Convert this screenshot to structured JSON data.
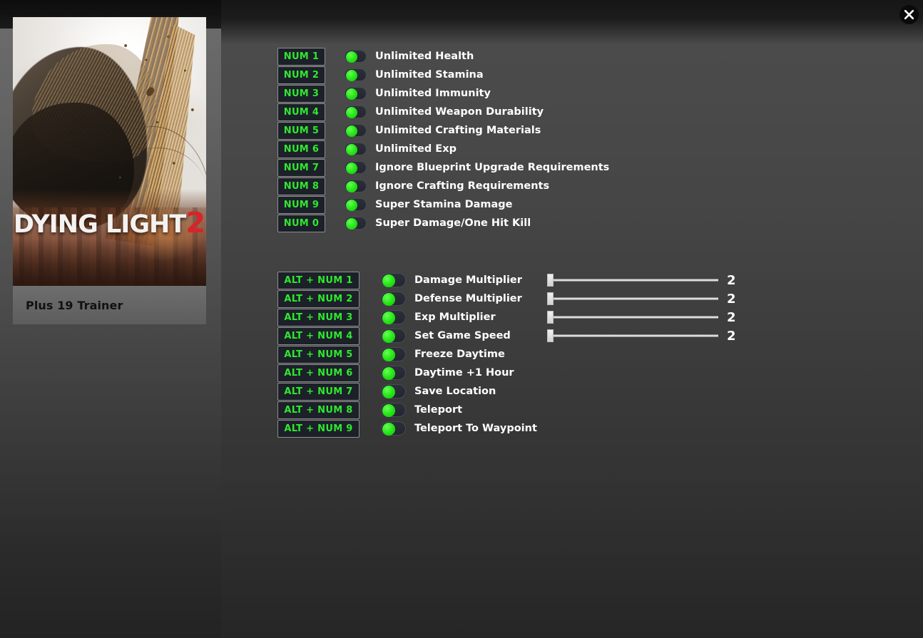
{
  "window": {
    "close_icon": "close-icon"
  },
  "cover": {
    "game_title_main": "DYING LIGHT",
    "game_title_number": "2",
    "caption": "Plus 19 Trainer"
  },
  "colors": {
    "hotkey_text": "#2fe82f",
    "toggle_on": "#22e414",
    "title_accent_red": "#d8232a",
    "label_text": "#ffffff",
    "slider_track": "#dcdcdc"
  },
  "section_1": {
    "rows": [
      {
        "hotkey": "NUM 1",
        "label": "Unlimited Health",
        "enabled": true
      },
      {
        "hotkey": "NUM 2",
        "label": "Unlimited Stamina",
        "enabled": true
      },
      {
        "hotkey": "NUM 3",
        "label": "Unlimited Immunity",
        "enabled": true
      },
      {
        "hotkey": "NUM 4",
        "label": "Unlimited Weapon Durability",
        "enabled": true
      },
      {
        "hotkey": "NUM 5",
        "label": "Unlimited Crafting Materials",
        "enabled": true
      },
      {
        "hotkey": "NUM 6",
        "label": "Unlimited Exp",
        "enabled": true
      },
      {
        "hotkey": "NUM 7",
        "label": "Ignore Blueprint Upgrade Requirements",
        "enabled": true
      },
      {
        "hotkey": "NUM 8",
        "label": "Ignore Crafting Requirements",
        "enabled": true
      },
      {
        "hotkey": "NUM 9",
        "label": "Super Stamina Damage",
        "enabled": true
      },
      {
        "hotkey": "NUM 0",
        "label": "Super Damage/One Hit Kill",
        "enabled": true
      }
    ]
  },
  "section_2": {
    "rows": [
      {
        "hotkey": "ALT + NUM 1",
        "label": "Damage Multiplier",
        "enabled": true,
        "has_slider": true,
        "value": "2"
      },
      {
        "hotkey": "ALT + NUM 2",
        "label": "Defense Multiplier",
        "enabled": true,
        "has_slider": true,
        "value": "2"
      },
      {
        "hotkey": "ALT + NUM 3",
        "label": "Exp Multiplier",
        "enabled": true,
        "has_slider": true,
        "value": "2"
      },
      {
        "hotkey": "ALT + NUM 4",
        "label": "Set Game Speed",
        "enabled": true,
        "has_slider": true,
        "value": "2"
      },
      {
        "hotkey": "ALT + NUM 5",
        "label": "Freeze Daytime",
        "enabled": true,
        "has_slider": false,
        "value": ""
      },
      {
        "hotkey": "ALT + NUM 6",
        "label": "Daytime +1 Hour",
        "enabled": true,
        "has_slider": false,
        "value": ""
      },
      {
        "hotkey": "ALT + NUM 7",
        "label": "Save Location",
        "enabled": true,
        "has_slider": false,
        "value": ""
      },
      {
        "hotkey": "ALT + NUM 8",
        "label": "Teleport",
        "enabled": true,
        "has_slider": false,
        "value": ""
      },
      {
        "hotkey": "ALT + NUM 9",
        "label": "Teleport To Waypoint",
        "enabled": true,
        "has_slider": false,
        "value": ""
      }
    ]
  }
}
